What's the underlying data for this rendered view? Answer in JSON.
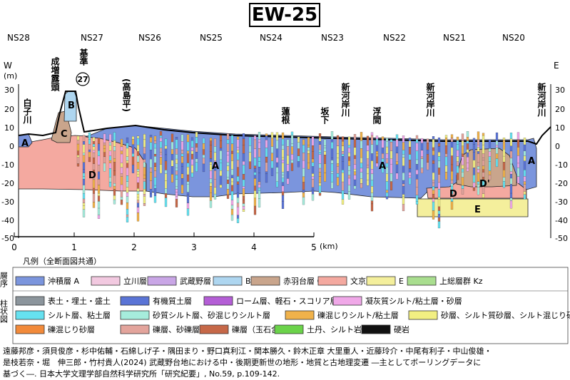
{
  "title": "EW-25",
  "sections": [
    "NS28",
    "NS27",
    "NS26",
    "NS25",
    "NS24",
    "NS23",
    "NS22",
    "NS21",
    "NS20"
  ],
  "direction": {
    "west": "W",
    "east": "E"
  },
  "axis": {
    "unit": "(m)",
    "ticks": [
      "30",
      "20",
      "10",
      "0",
      "-10",
      "-20",
      "-30",
      "-40",
      "-50"
    ],
    "x_ticks": [
      "0",
      "1",
      "2",
      "3",
      "4",
      "5"
    ],
    "x_unit": "(km)"
  },
  "place_labels": {
    "shirakogawa": "白子川",
    "narimasu": "成増露頭",
    "kijun": "基準",
    "kijun_num": "27",
    "takashimadaira": "(高島平)",
    "hasune": "蓮根",
    "sakashita": "坂下",
    "shingashi1": "新河岸川",
    "ukima": "浮間",
    "shingashi2": "新河岸川",
    "shingashi3": "新河岸川"
  },
  "unit_labels": {
    "A1": "A",
    "A2": "A",
    "A3": "A",
    "A4": "A",
    "B": "B",
    "C": "C",
    "D1": "D",
    "D2": "D",
    "D3": "D'",
    "E": "E"
  },
  "colors": {
    "A": "#7b95dd",
    "Tc": "#f2c9e0",
    "M": "#c9a6e6",
    "B": "#aed6f0",
    "C": "#c9a58c",
    "D": "#f4a9a0",
    "E": "#f4ef9c",
    "Kz": "#a9de8f",
    "fill": "#8c959c",
    "organic": "#5a74d6",
    "loam": "#b45ed6",
    "tuff": "#f0a8e8",
    "silt": "#66e1f0",
    "sandysilt": "#a6ecdc",
    "gravelsilt": "#f0b24b",
    "sand": "#f2ef82",
    "gravelsand": "#f28a3a",
    "gravel": "#e3a49c",
    "pebble": "#c66848",
    "tanto": "#6bd34a",
    "hard": "#111111"
  },
  "legend": {
    "title": "凡例（全断面図共通）",
    "strat_heading": "層序",
    "col_heading": "柱状図",
    "strat": [
      {
        "label": "沖積層 A",
        "color": "#7b95dd"
      },
      {
        "label": "立川層 Tc",
        "color": "#f2c9e0"
      },
      {
        "label": "武蔵野層 M",
        "color": "#c9a6e6"
      },
      {
        "label": "B",
        "color": "#aed6f0"
      },
      {
        "label": "赤羽台層 C",
        "color": "#c9a58c"
      },
      {
        "label": "文京層 D",
        "color": "#f4a9a0"
      },
      {
        "label": "E",
        "color": "#f4ef9c"
      },
      {
        "label": "上総層群 Kz",
        "color": "#a9de8f"
      }
    ],
    "col_row1": [
      {
        "label": "表土・埋土・盛土",
        "color": "#8c959c"
      },
      {
        "label": "有機質土層",
        "color": "#5a74d6"
      },
      {
        "label": "ローム層、軽石・スコリア層",
        "color": "#b45ed6"
      },
      {
        "label": "凝灰質シルト/粘土層・砂層",
        "color": "#f0a8e8"
      }
    ],
    "col_row2": [
      {
        "label": "シルト層、粘土層",
        "color": "#66e1f0"
      },
      {
        "label": "砂質シルト層、砂混じりシルト層",
        "color": "#a6ecdc"
      },
      {
        "label": "礫混じりシルト/粘土層",
        "color": "#f0b24b"
      },
      {
        "label": "砂層、シルト質砂層、シルト混じり砂層",
        "color": "#f2ef82"
      }
    ],
    "col_row3": [
      {
        "label": "礫混じり砂層",
        "color": "#f28a3a"
      },
      {
        "label": "礫層、砂礫層",
        "color": "#e3a49c"
      },
      {
        "label": "礫層（玉石含有）",
        "color": "#c66848"
      },
      {
        "label": "土丹、シルト岩",
        "color": "#6bd34a"
      },
      {
        "label": "硬岩",
        "color": "#111111"
      }
    ]
  },
  "citation": {
    "line1": "遠藤邦彦・須貝俊彦・杉中佑輔・石綿しげ子・隅田まり・野口真利江・関本勝久・鈴木正章 大里重人・近藤玲介・中尾有利子・中山俊雄・",
    "line2": "是枝若奈・堀　伸三郎・竹村貴人(2024) 武蔵野台地における中・後期更新世の地形・地質と古地理変遷 ―主としてボーリングデータに",
    "line3": "基づく―. 日本大学文理学部自然科学研究所「研究紀要」, No.59, p.109-142."
  }
}
